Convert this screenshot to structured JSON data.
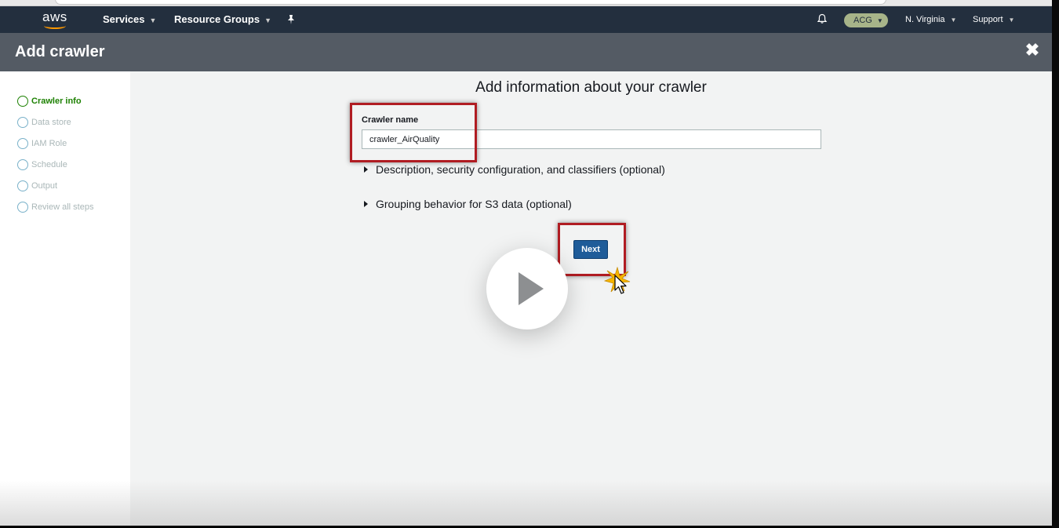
{
  "topnav": {
    "logo_text": "aws",
    "services": "Services",
    "resource_groups": "Resource Groups",
    "account": "ACG",
    "region": "N. Virginia",
    "support": "Support"
  },
  "header": {
    "title": "Add crawler"
  },
  "sidebar": {
    "steps": [
      {
        "label": "Crawler info",
        "active": true
      },
      {
        "label": "Data store",
        "active": false
      },
      {
        "label": "IAM Role",
        "active": false
      },
      {
        "label": "Schedule",
        "active": false
      },
      {
        "label": "Output",
        "active": false
      },
      {
        "label": "Review all steps",
        "active": false
      }
    ]
  },
  "main": {
    "heading": "Add information about your crawler",
    "crawler_name_label": "Crawler name",
    "crawler_name_value": "crawler_AirQuality",
    "expander_description": "Description, security configuration, and classifiers (optional)",
    "expander_grouping": "Grouping behavior for S3 data (optional)",
    "next_label": "Next"
  },
  "colors": {
    "nav_bg": "#232f3e",
    "header_bg": "#545b64",
    "active_step": "#1d8102",
    "primary_button": "#1f5c99",
    "highlight": "#b01c22",
    "aws_orange": "#ff9900"
  },
  "icons": {
    "pin": "pin-icon",
    "bell": "bell-icon",
    "close": "close-icon",
    "play": "play-icon",
    "cursor": "cursor-icon"
  }
}
